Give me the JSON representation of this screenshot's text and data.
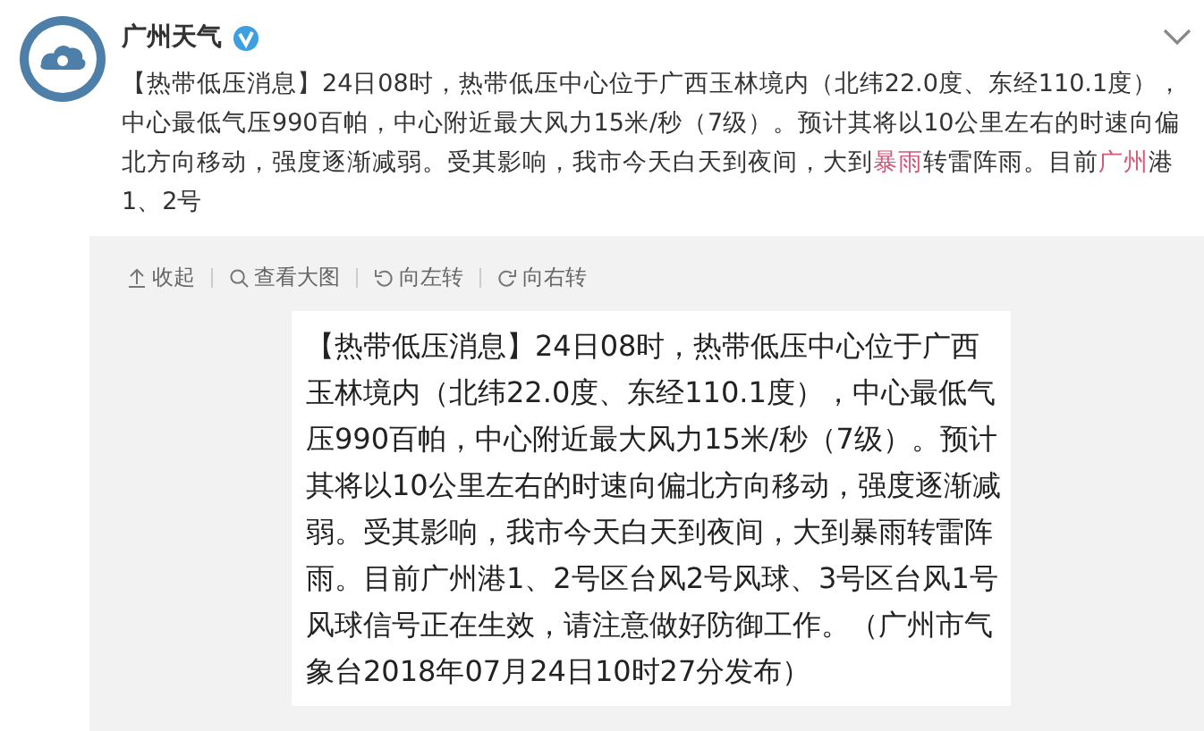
{
  "post": {
    "author": "广州天气",
    "verified": true,
    "segments": [
      {
        "kind": "plain",
        "text": "【热带低压消息】24日08时，热带低压中心位于广西玉林境内（北纬22.0度、东经110.1度），中心最低气压990百帕，中心附近最大风力15米/秒（7级）。预计其将以10公里左右的时速向偏北方向移动，强度逐渐减弱。受其影响，我市今天白天到夜间，大到"
      },
      {
        "kind": "link",
        "text": "暴雨"
      },
      {
        "kind": "plain",
        "text": "转雷阵雨。目前"
      },
      {
        "kind": "link",
        "text": "广州"
      },
      {
        "kind": "plain",
        "text": "港1、2号"
      }
    ]
  },
  "media_toolbar": [
    {
      "kind": "collapse",
      "label": "收起"
    },
    {
      "kind": "zoom",
      "label": "查看大图"
    },
    {
      "kind": "rotate-left",
      "label": "向左转"
    },
    {
      "kind": "rotate-right",
      "label": "向右转"
    }
  ],
  "image_text": "【热带低压消息】24日08时，热带低压中心位于广西玉林境内（北纬22.0度、东经110.1度），中心最低气压990百帕，中心附近最大风力15米/秒（7级）。预计其将以10公里左右的时速向偏北方向移动，强度逐渐减弱。受其影响，我市今天白天到夜间，大到暴雨转雷阵雨。目前广州港1、2号区台风2号风球、3号区台风1号风球信号正在生效，请注意做好防御工作。（广州市气象台2018年07月24日10时27分发布）"
}
